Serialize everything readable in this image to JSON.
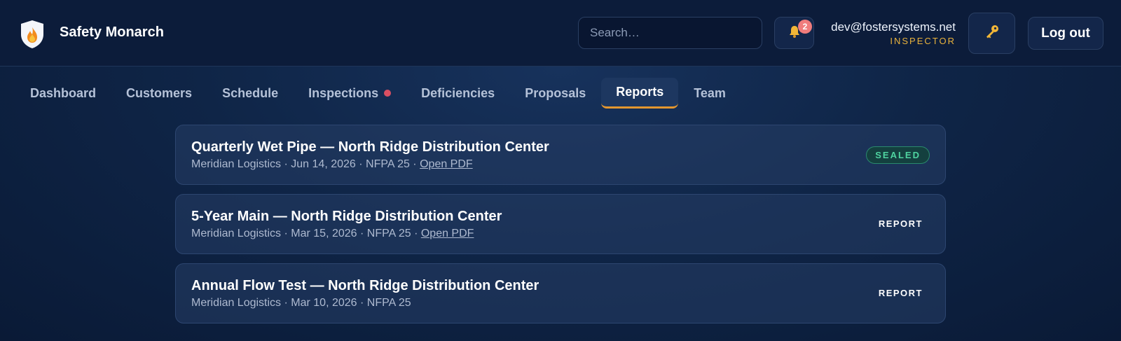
{
  "app": {
    "brand": "Safety Monarch"
  },
  "header": {
    "search_placeholder": "Search…",
    "notification_count": "2",
    "user_email": "dev@fostersystems.net",
    "user_role": "INSPECTOR",
    "logout_label": "Log out",
    "icons": {
      "logo": "shield-flame-icon",
      "notifications": "bell-icon",
      "key": "key-icon"
    }
  },
  "nav": {
    "tabs": [
      {
        "label": "Dashboard"
      },
      {
        "label": "Customers"
      },
      {
        "label": "Schedule"
      },
      {
        "label": "Inspections"
      },
      {
        "label": "Deficiencies"
      },
      {
        "label": "Proposals"
      },
      {
        "label": "Reports"
      },
      {
        "label": "Team"
      }
    ],
    "active_tab": "Reports"
  },
  "reports": [
    {
      "title": "Quarterly Wet Pipe — North Ridge Distribution Center",
      "meta": "Meridian Logistics · Jun 14, 2026 · NFPA 25 ·",
      "link": "Open PDF",
      "status": "SEALED"
    },
    {
      "title": "5-Year Main — North Ridge Distribution Center",
      "meta": "Meridian Logistics · Mar 15, 2026 · NFPA 25 ·",
      "link": "Open PDF",
      "action": "REPORT"
    },
    {
      "title": "Annual Flow Test — North Ridge Distribution Center",
      "meta": "Meridian Logistics · Mar 10, 2026 · NFPA 25",
      "action": "REPORT"
    }
  ],
  "colors": {
    "background": "#0f2547",
    "accent": "#e4972f",
    "role": "#e8b23c",
    "sealed": "#4fd3a0",
    "badge": "#f07c7c",
    "alert_dot": "#d94f62"
  }
}
